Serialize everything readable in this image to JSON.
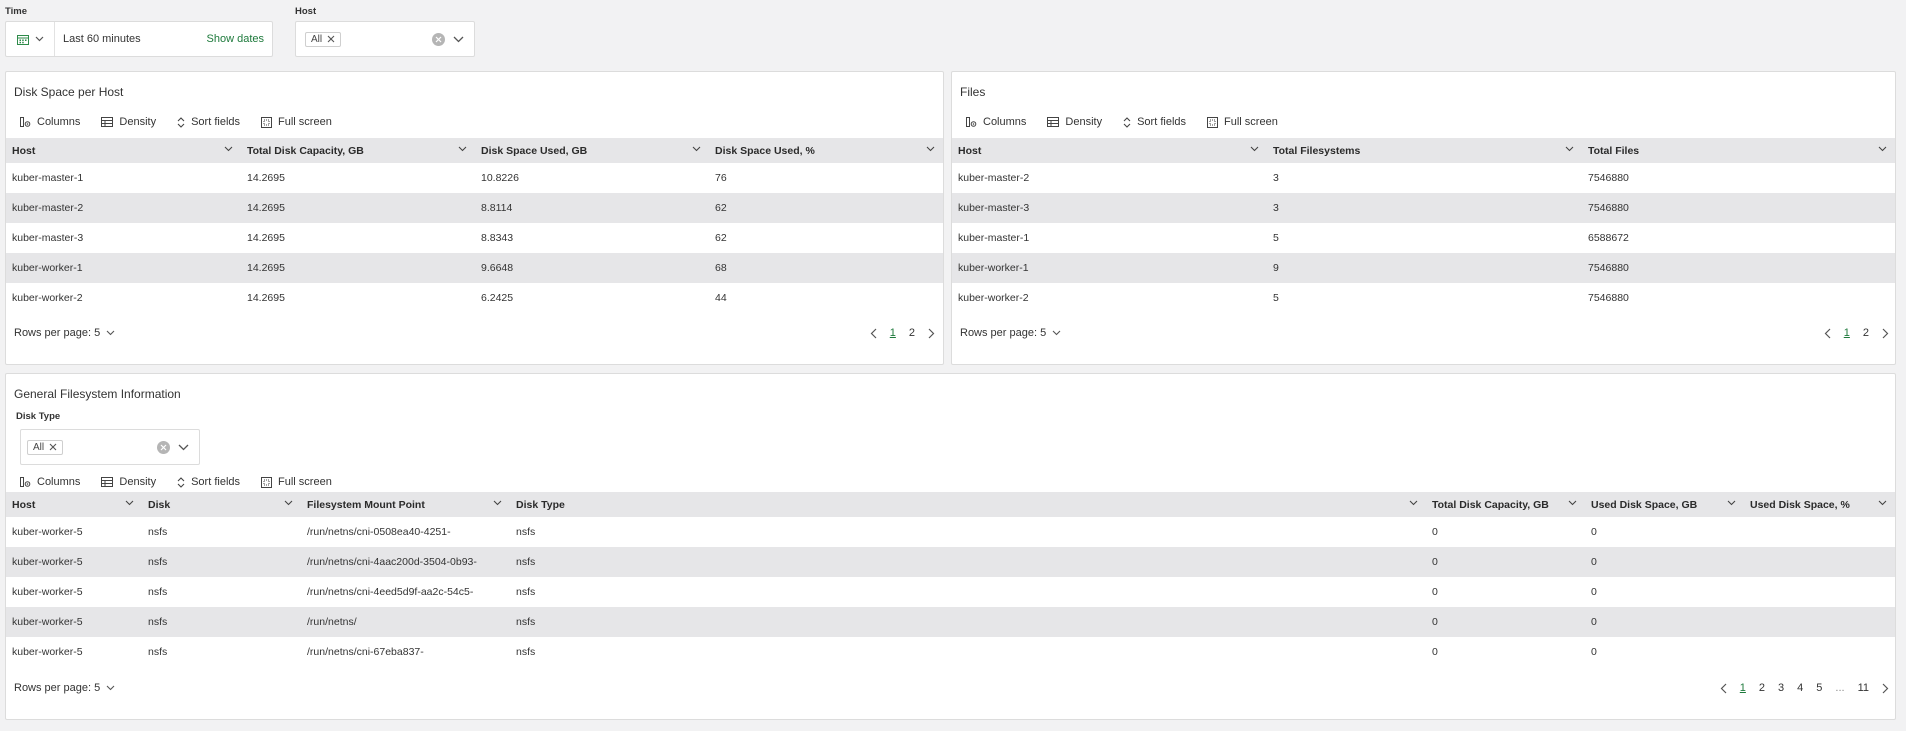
{
  "filters": {
    "time": {
      "label": "Time",
      "range": "Last 60 minutes",
      "show_dates": "Show dates"
    },
    "host": {
      "label": "Host",
      "chip": "All"
    }
  },
  "toolbar": {
    "columns": "Columns",
    "density": "Density",
    "sort_fields": "Sort fields",
    "full_screen": "Full screen"
  },
  "disk_space_panel": {
    "title": "Disk Space per Host",
    "headers": [
      "Host",
      "Total Disk Capacity, GB",
      "Disk Space Used, GB",
      "Disk Space Used, %"
    ],
    "rows": [
      [
        "kuber-master-1",
        "14.2695",
        "10.8226",
        "76"
      ],
      [
        "kuber-master-2",
        "14.2695",
        "8.8114",
        "62"
      ],
      [
        "kuber-master-3",
        "14.2695",
        "8.8343",
        "62"
      ],
      [
        "kuber-worker-1",
        "14.2695",
        "9.6648",
        "68"
      ],
      [
        "kuber-worker-2",
        "14.2695",
        "6.2425",
        "44"
      ]
    ],
    "rows_per_page": "Rows per page: 5",
    "pages": [
      "1",
      "2"
    ]
  },
  "files_panel": {
    "title": "Files",
    "headers": [
      "Host",
      "Total Filesystems",
      "Total Files"
    ],
    "rows": [
      [
        "kuber-master-2",
        "3",
        "7546880"
      ],
      [
        "kuber-master-3",
        "3",
        "7546880"
      ],
      [
        "kuber-master-1",
        "5",
        "6588672"
      ],
      [
        "kuber-worker-1",
        "9",
        "7546880"
      ],
      [
        "kuber-worker-2",
        "5",
        "7546880"
      ]
    ],
    "rows_per_page": "Rows per page: 5",
    "pages": [
      "1",
      "2"
    ]
  },
  "general_panel": {
    "title": "General Filesystem Information",
    "disk_type_label": "Disk Type",
    "disk_type_chip": "All",
    "headers": [
      "Host",
      "Disk",
      "Filesystem Mount Point",
      "Disk Type",
      "Total Disk Capacity, GB",
      "Used Disk Space, GB",
      "Used Disk Space, %"
    ],
    "rows": [
      [
        "kuber-worker-5",
        "nsfs",
        "/run/netns/cni-0508ea40-4251-",
        "nsfs",
        "0",
        "0",
        ""
      ],
      [
        "kuber-worker-5",
        "nsfs",
        "/run/netns/cni-4aac200d-3504-0b93-",
        "nsfs",
        "0",
        "0",
        ""
      ],
      [
        "kuber-worker-5",
        "nsfs",
        "/run/netns/cni-4eed5d9f-aa2c-54c5-",
        "nsfs",
        "0",
        "0",
        ""
      ],
      [
        "kuber-worker-5",
        "nsfs",
        "/run/netns/",
        "nsfs",
        "0",
        "0",
        ""
      ],
      [
        "kuber-worker-5",
        "nsfs",
        "/run/netns/cni-67eba837-",
        "nsfs",
        "0",
        "0",
        ""
      ]
    ],
    "rows_per_page": "Rows per page: 5",
    "pages": [
      "1",
      "2",
      "3",
      "4",
      "5",
      "...",
      "11"
    ]
  }
}
